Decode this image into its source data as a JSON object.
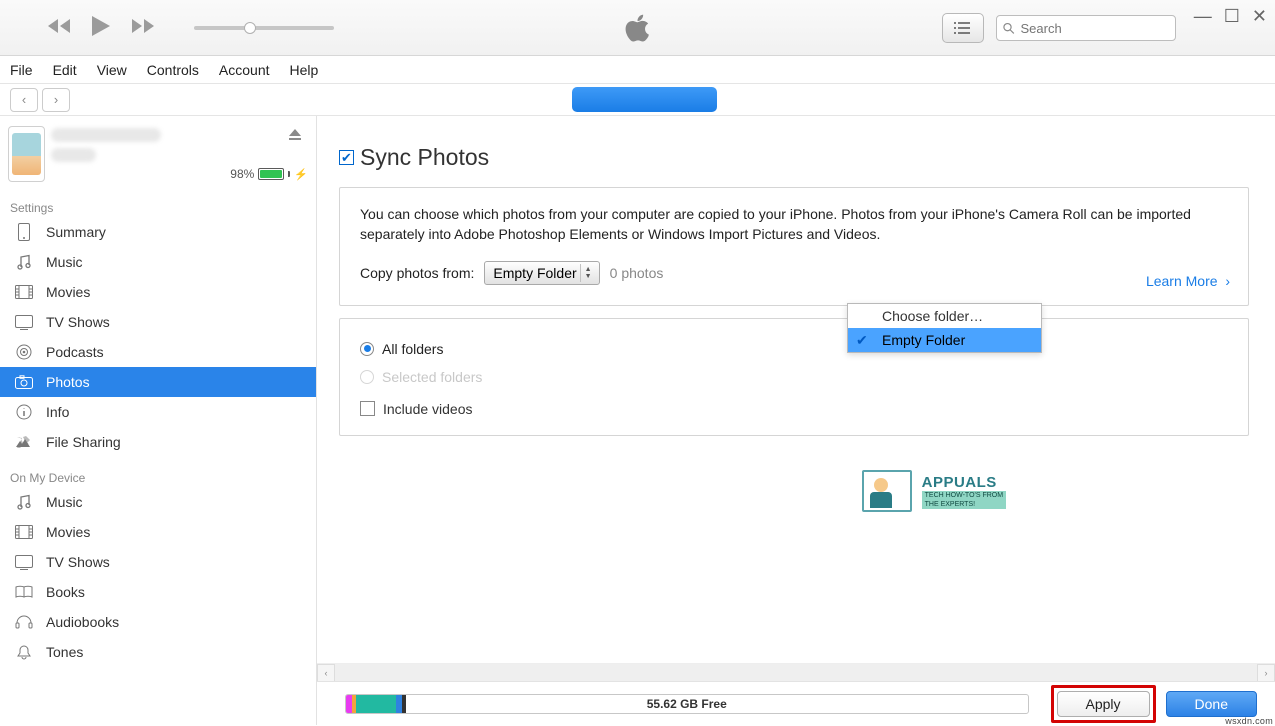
{
  "topbar": {
    "search_placeholder": "Search"
  },
  "menubar": [
    "File",
    "Edit",
    "View",
    "Controls",
    "Account",
    "Help"
  ],
  "device": {
    "battery_pct": "98%"
  },
  "sidebar": {
    "settings_heading": "Settings",
    "settings": [
      {
        "label": "Summary",
        "icon": "device-icon"
      },
      {
        "label": "Music",
        "icon": "music-icon"
      },
      {
        "label": "Movies",
        "icon": "movie-icon"
      },
      {
        "label": "TV Shows",
        "icon": "tv-icon"
      },
      {
        "label": "Podcasts",
        "icon": "podcast-icon"
      },
      {
        "label": "Photos",
        "icon": "photo-icon"
      },
      {
        "label": "Info",
        "icon": "info-icon"
      },
      {
        "label": "File Sharing",
        "icon": "share-icon"
      }
    ],
    "device_heading": "On My Device",
    "device_items": [
      {
        "label": "Music",
        "icon": "music-icon"
      },
      {
        "label": "Movies",
        "icon": "movie-icon"
      },
      {
        "label": "TV Shows",
        "icon": "tv-icon"
      },
      {
        "label": "Books",
        "icon": "book-icon"
      },
      {
        "label": "Audiobooks",
        "icon": "audiobook-icon"
      },
      {
        "label": "Tones",
        "icon": "tone-icon"
      }
    ]
  },
  "main": {
    "sync_title": "Sync Photos",
    "info_text": "You can choose which photos from your computer are copied to your iPhone. Photos from your iPhone's Camera Roll can be imported separately into Adobe Photoshop Elements or Windows Import Pictures and Videos.",
    "copy_label": "Copy photos from:",
    "dropdown_value": "Empty Folder",
    "photo_count": "0 photos",
    "learn_more": "Learn More",
    "dropdown_opts": {
      "choose": "Choose folder…",
      "empty": "Empty Folder"
    },
    "radio_all": "All folders",
    "radio_selected": "Selected folders",
    "include_videos": "Include videos"
  },
  "bottom": {
    "free_text": "55.62 GB Free",
    "apply": "Apply",
    "done": "Done"
  },
  "watermark": {
    "brand": "APPUALS",
    "line1": "TECH HOW-TO'S FROM",
    "line2": "THE EXPERTS!"
  },
  "source_tag": "wsxdn.com"
}
